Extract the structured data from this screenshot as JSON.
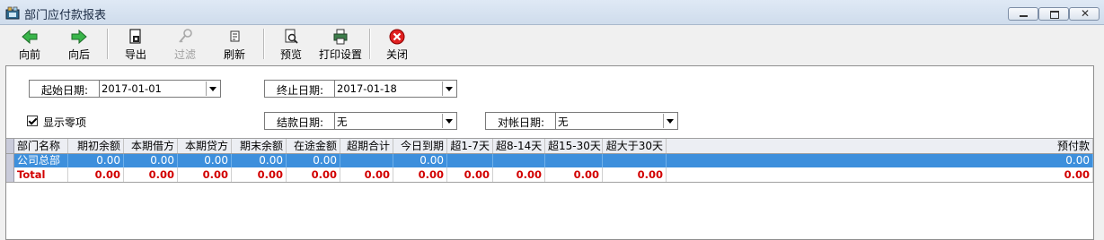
{
  "window": {
    "title": "部门应付款报表"
  },
  "toolbar": {
    "back": "向前",
    "forward": "向后",
    "export": "导出",
    "filter": "过滤",
    "refresh": "刷新",
    "preview": "预览",
    "print_setup": "打印设置",
    "close": "关闭"
  },
  "form": {
    "start_date_label": "起始日期:",
    "start_date_value": "2017-01-01",
    "end_date_label": "终止日期:",
    "end_date_value": "2017-01-18",
    "settle_date_label": "结款日期:",
    "settle_date_value": "无",
    "reconcile_date_label": "对帐日期:",
    "reconcile_date_value": "无",
    "show_zero_label": "显示零项"
  },
  "table": {
    "columns": [
      "部门名称",
      "期初余额",
      "本期借方",
      "本期贷方",
      "期末余额",
      "在途金额",
      "超期合计",
      "今日到期",
      "超1-7天",
      "超8-14天",
      "超15-30天",
      "超大于30天",
      "预付款"
    ],
    "rows": [
      [
        "公司总部",
        "0.00",
        "0.00",
        "0.00",
        "0.00",
        "0.00",
        "",
        "0.00",
        "",
        "",
        "",
        "",
        "0.00"
      ]
    ],
    "total": [
      "Total",
      "0.00",
      "0.00",
      "0.00",
      "0.00",
      "0.00",
      "0.00",
      "0.00",
      "0.00",
      "0.00",
      "0.00",
      "0.00",
      "0.00"
    ]
  },
  "colors": {
    "selected_row": "#3d8fdc",
    "total_text": "#d20000"
  }
}
